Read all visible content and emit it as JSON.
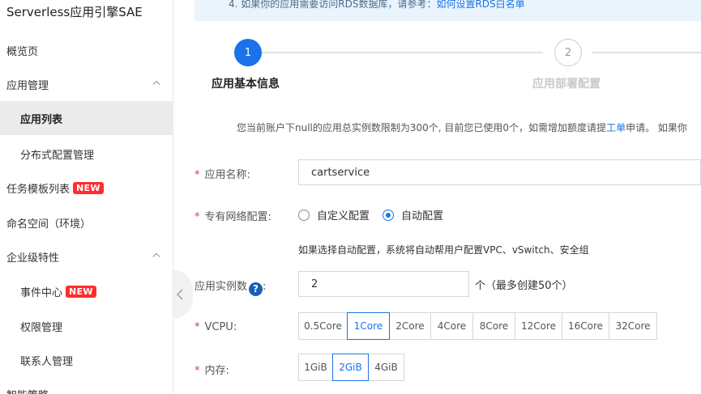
{
  "sidebar": {
    "title": "Serverless应用引擎SAE",
    "items": [
      {
        "label": "概览页"
      },
      {
        "label": "应用管理"
      },
      {
        "label": "应用列表"
      },
      {
        "label": "分布式配置管理"
      },
      {
        "label": "任务模板列表",
        "badge": "NEW"
      },
      {
        "label": "命名空间（环境）"
      },
      {
        "label": "企业级特性"
      },
      {
        "label": "事件中心",
        "badge": "NEW"
      },
      {
        "label": "权限管理"
      },
      {
        "label": "联系人管理"
      },
      {
        "label": "智能策略"
      }
    ]
  },
  "notice": {
    "text": "4. 如果你的应用需要访问RDS数据库，请参考：",
    "link": "如何设置RDS白名单"
  },
  "steps": [
    {
      "number": "1",
      "title": "应用基本信息"
    },
    {
      "number": "2",
      "title": "应用部署配置"
    }
  ],
  "quota": {
    "before": "您当前账户下null的应用总实例数限制为300个, 目前您已使用0个，如需增加额度请提",
    "link": "工单",
    "after": "申请。 如果你"
  },
  "form": {
    "app_name": {
      "label": "应用名称:",
      "value": "cartservice"
    },
    "vpc": {
      "label": "专有网络配置:",
      "options": [
        "自定义配置",
        "自动配置"
      ],
      "selected": "自动配置",
      "hint": "如果选择自动配置，系统将自动帮用户配置VPC、vSwitch、安全组"
    },
    "instances": {
      "label": "应用实例数",
      "colon": ":",
      "value": "2",
      "unit": "个（最多创建50个）"
    },
    "vcpu": {
      "label": "VCPU:",
      "options": [
        "0.5Core",
        "1Core",
        "2Core",
        "4Core",
        "8Core",
        "12Core",
        "16Core",
        "32Core"
      ],
      "selected": "1Core"
    },
    "memory": {
      "label": "内存:",
      "options": [
        "1GiB",
        "2GiB",
        "4GiB"
      ],
      "selected": "2GiB"
    }
  },
  "colors": {
    "accent": "#1a73e8",
    "required": "#e53935",
    "badge": "#ff2d2d",
    "active_bg": "#ebebeb"
  }
}
